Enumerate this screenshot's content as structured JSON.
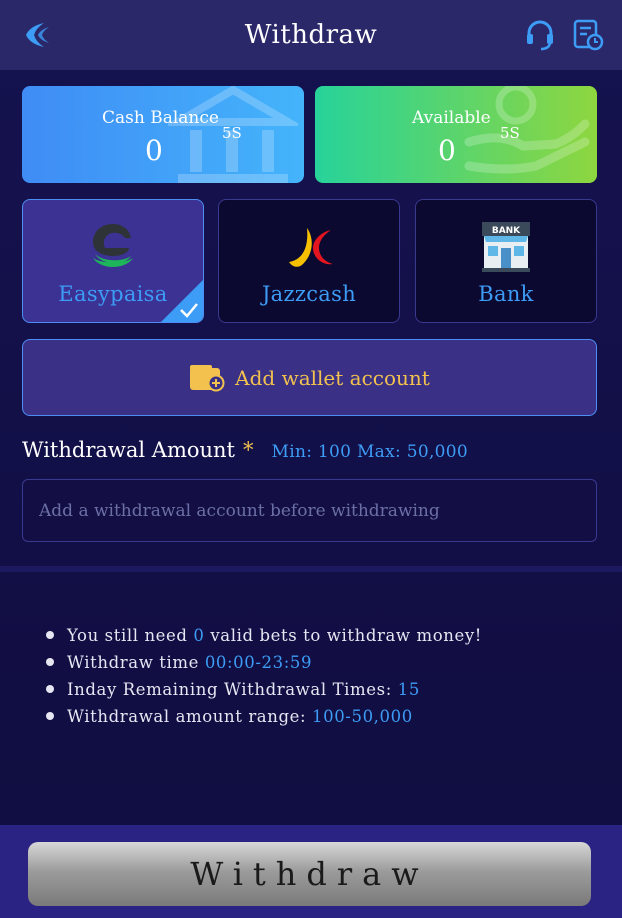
{
  "header": {
    "title": "Withdraw",
    "back_icon": "back-arrow-icon",
    "support_icon": "headset-icon",
    "records_icon": "record-clock-icon"
  },
  "balances": {
    "cash": {
      "label": "Cash Balance",
      "value": "0",
      "timer": "5S",
      "icon": "bank-icon"
    },
    "available": {
      "label": "Available",
      "value": "0",
      "timer": "5S",
      "icon": "hand-coin-icon"
    }
  },
  "methods": [
    {
      "label": "Easypaisa",
      "selected": true,
      "icon": "easypaisa-logo-icon"
    },
    {
      "label": "Jazzcash",
      "selected": false,
      "icon": "jazzcash-logo-icon"
    },
    {
      "label": "Bank",
      "selected": false,
      "icon": "bank-building-icon"
    }
  ],
  "add_wallet": {
    "label": "Add wallet account",
    "icon": "wallet-add-icon"
  },
  "amount": {
    "title": "Withdrawal Amount",
    "required_mark": "*",
    "minmax": "Min: 100 Max: 50,000",
    "placeholder": "Add a withdrawal account before withdrawing"
  },
  "tips": [
    {
      "before": "You still need ",
      "highlight": "0",
      "after": " valid bets to withdraw money!"
    },
    {
      "before": "Withdraw time ",
      "highlight": "00:00-23:59",
      "after": ""
    },
    {
      "before": "Inday Remaining Withdrawal Times: ",
      "highlight": "15",
      "after": ""
    },
    {
      "before": "Withdrawal amount range: ",
      "highlight": "100-50,000",
      "after": ""
    }
  ],
  "submit": {
    "label": "Withdraw"
  },
  "colors": {
    "accent_blue": "#3d9cf5",
    "gold": "#f2c14e",
    "bg": "#120f47"
  }
}
